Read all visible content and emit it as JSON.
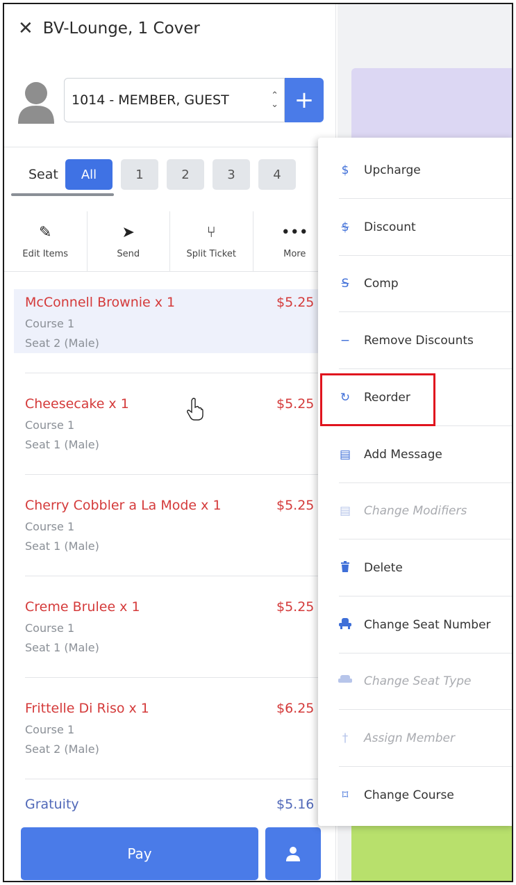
{
  "header": {
    "close_icon": "close-icon",
    "title": "BV-Lounge, 1 Cover"
  },
  "member": {
    "selected": "1014 - MEMBER, GUEST",
    "add_icon": "+"
  },
  "seats": {
    "label": "Seat",
    "tabs": [
      "All",
      "1",
      "2",
      "3",
      "4"
    ],
    "active": "All"
  },
  "actions": [
    {
      "label": "Edit Items",
      "icon": "pencil-icon"
    },
    {
      "label": "Send",
      "icon": "send-icon"
    },
    {
      "label": "Split Ticket",
      "icon": "split-icon"
    },
    {
      "label": "More",
      "icon": "more-icon"
    }
  ],
  "items": [
    {
      "name": "McConnell Brownie x 1",
      "price": "$5.25",
      "course": "Course 1",
      "seat": "Seat 2 (Male)"
    },
    {
      "name": "Cheesecake x 1",
      "price": "$5.25",
      "course": "Course 1",
      "seat": "Seat 1 (Male)"
    },
    {
      "name": "Cherry Cobbler a La Mode x 1",
      "price": "$5.25",
      "course": "Course 1",
      "seat": "Seat 1 (Male)"
    },
    {
      "name": "Creme Brulee x 1",
      "price": "$5.25",
      "course": "Course 1",
      "seat": "Seat 1 (Male)"
    },
    {
      "name": "Frittelle Di Riso x 1",
      "price": "$6.25",
      "course": "Course 1",
      "seat": "Seat 2 (Male)"
    }
  ],
  "gratuity": {
    "label": "Gratuity",
    "amount": "$5.16"
  },
  "footer": {
    "pay_label": "Pay"
  },
  "menu": [
    {
      "label": "Upcharge",
      "icon": "$",
      "disabled": false
    },
    {
      "label": "Discount",
      "icon": "$",
      "disabled": false
    },
    {
      "label": "Comp",
      "icon": "S",
      "disabled": false
    },
    {
      "label": "Remove Discounts",
      "icon": "−",
      "disabled": false
    },
    {
      "label": "Reorder",
      "icon": "↻",
      "disabled": false
    },
    {
      "label": "Add Message",
      "icon": "▤",
      "disabled": false
    },
    {
      "label": "Change Modifiers",
      "icon": "▤",
      "disabled": true
    },
    {
      "label": "Delete",
      "icon": "🗑",
      "disabled": false
    },
    {
      "label": "Change Seat Number",
      "icon": "seat",
      "disabled": false
    },
    {
      "label": "Change Seat Type",
      "icon": "seat",
      "disabled": true
    },
    {
      "label": "Assign Member",
      "icon": "†",
      "disabled": true
    },
    {
      "label": "Change Course",
      "icon": "⌑",
      "disabled": false
    }
  ],
  "colors": {
    "primary": "#4a7be8",
    "item_red": "#d43a3a",
    "highlight_red": "#e0141e"
  }
}
